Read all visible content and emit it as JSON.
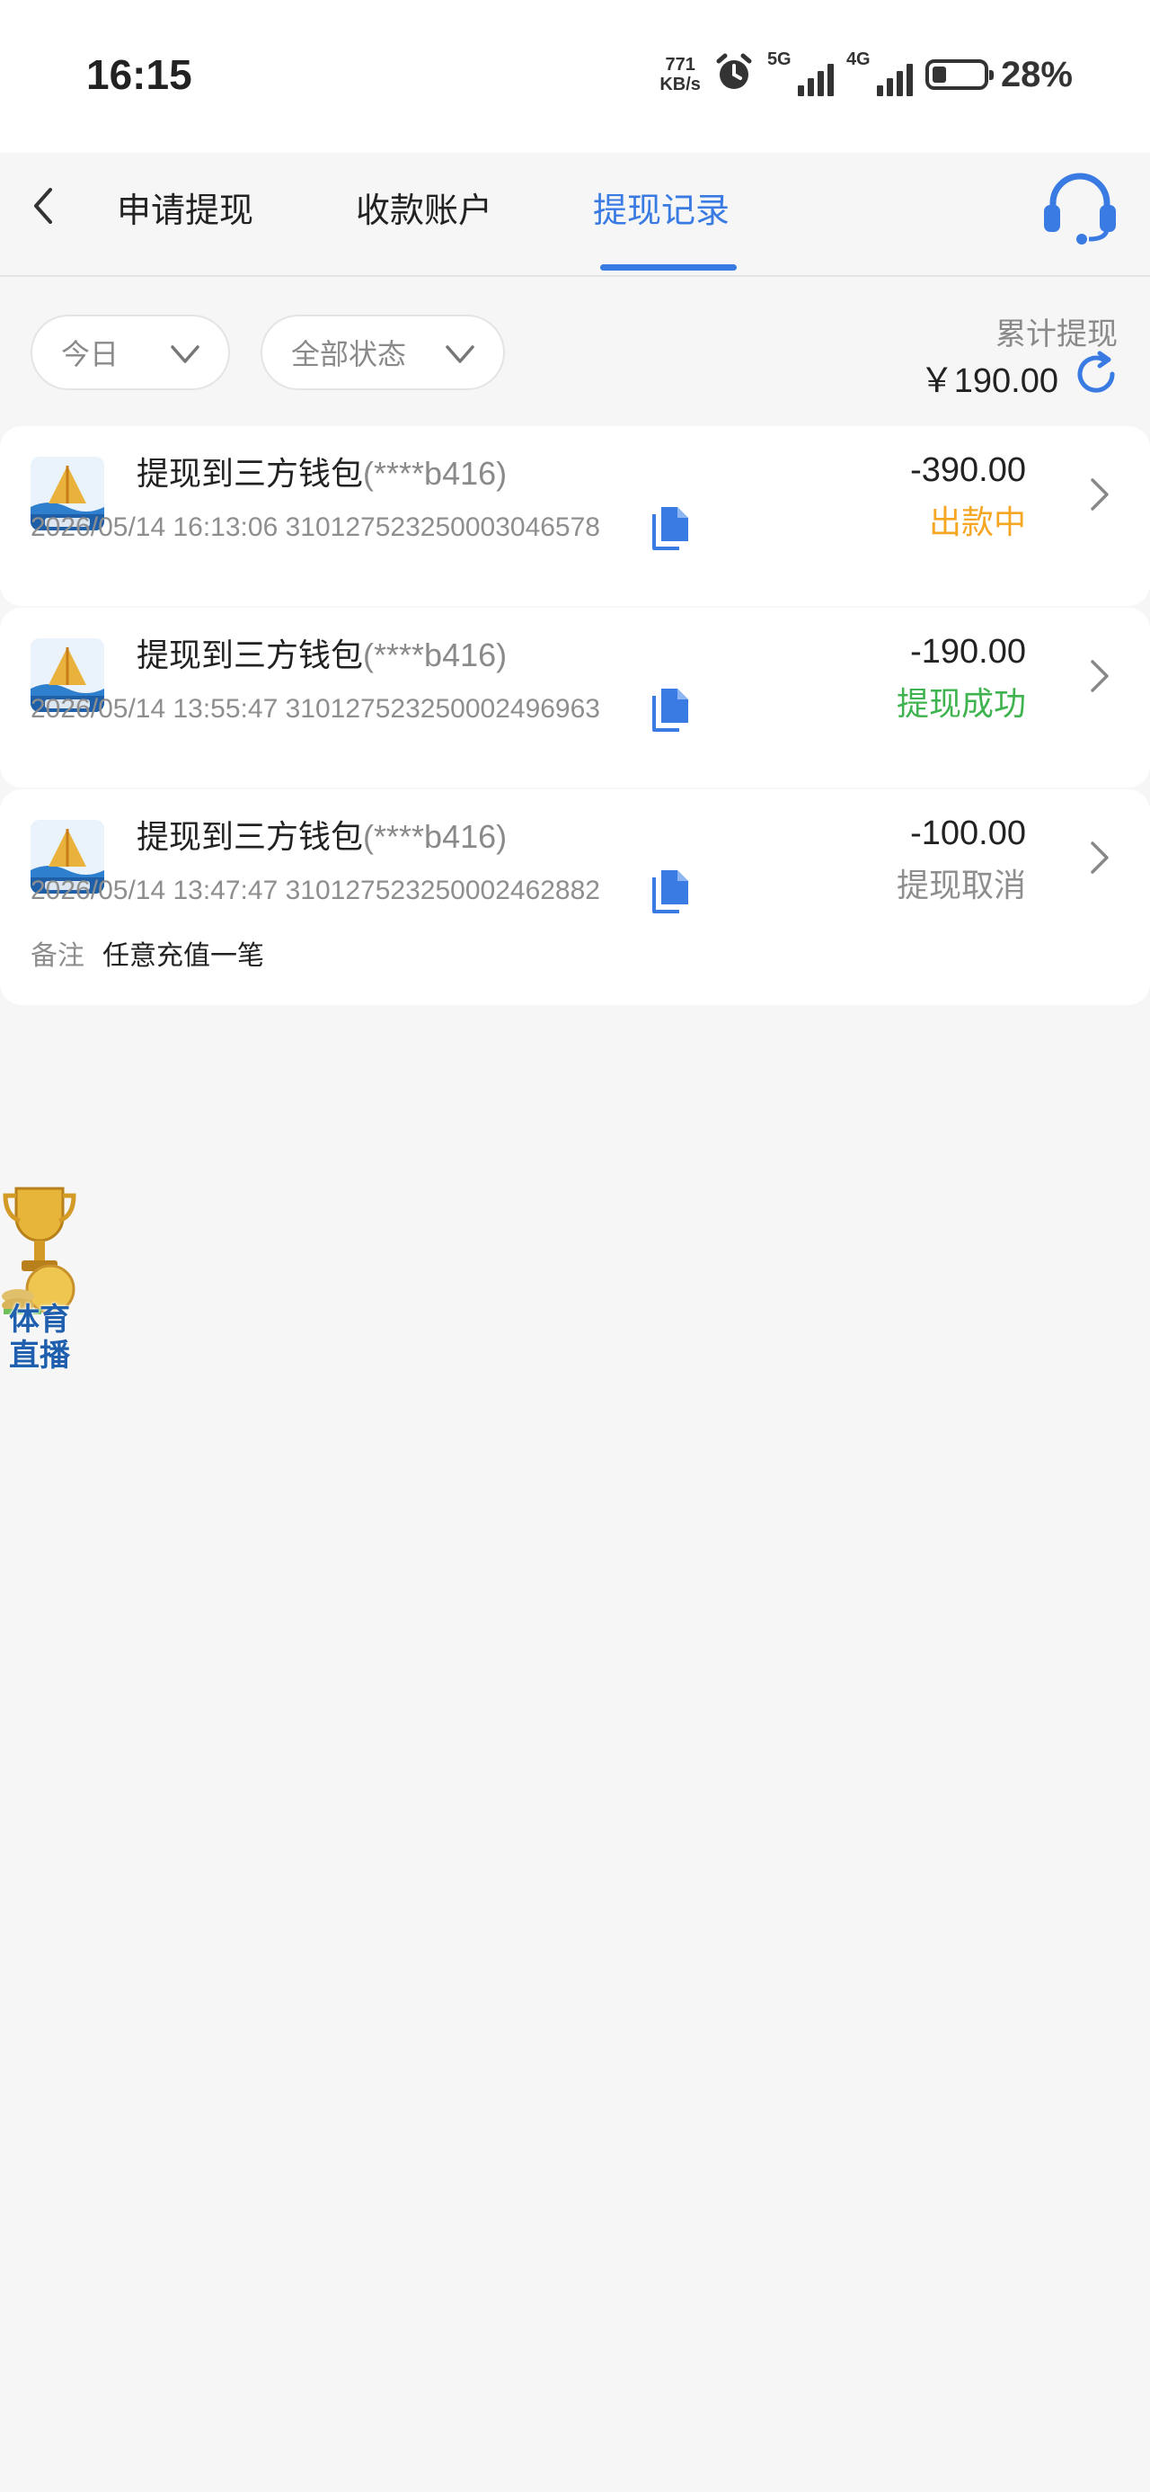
{
  "status_bar": {
    "time": "16:15",
    "net_speed_value": "771",
    "net_speed_unit": "KB/s",
    "signal_1_label": "5G",
    "signal_2_label": "4G",
    "battery_percent": "28%",
    "battery_level": 0.28
  },
  "header": {
    "tabs": [
      {
        "label": "申请提现",
        "active": false
      },
      {
        "label": "收款账户",
        "active": false
      },
      {
        "label": "提现记录",
        "active": true
      }
    ],
    "accent_color": "#3a7be3"
  },
  "filters": {
    "date_label": "今日",
    "status_label": "全部状态"
  },
  "summary": {
    "total_label": "累计提现",
    "total_value": "￥190.00"
  },
  "records": [
    {
      "title": "提现到三方钱包",
      "account_masked": "(****b416)",
      "datetime": "2026/05/14 16:13:06",
      "order_no": "310127523250003046578",
      "amount": "-390.00",
      "status": "出款中",
      "status_color": "#f5a623",
      "note_label": "",
      "note": ""
    },
    {
      "title": "提现到三方钱包",
      "account_masked": "(****b416)",
      "datetime": "2026/05/14 13:55:47",
      "order_no": "310127523250002496963",
      "amount": "-190.00",
      "status": "提现成功",
      "status_color": "#3fb34f",
      "note_label": "",
      "note": ""
    },
    {
      "title": "提现到三方钱包",
      "account_masked": "(****b416)",
      "datetime": "2026/05/14 13:47:47",
      "order_no": "310127523250002462882",
      "amount": "-100.00",
      "status": "提现取消",
      "status_color": "#8e8e8e",
      "note_label": "备注",
      "note": "任意充值一笔"
    }
  ],
  "float_ad": {
    "label_line1": "体育",
    "label_line2": "直播"
  }
}
